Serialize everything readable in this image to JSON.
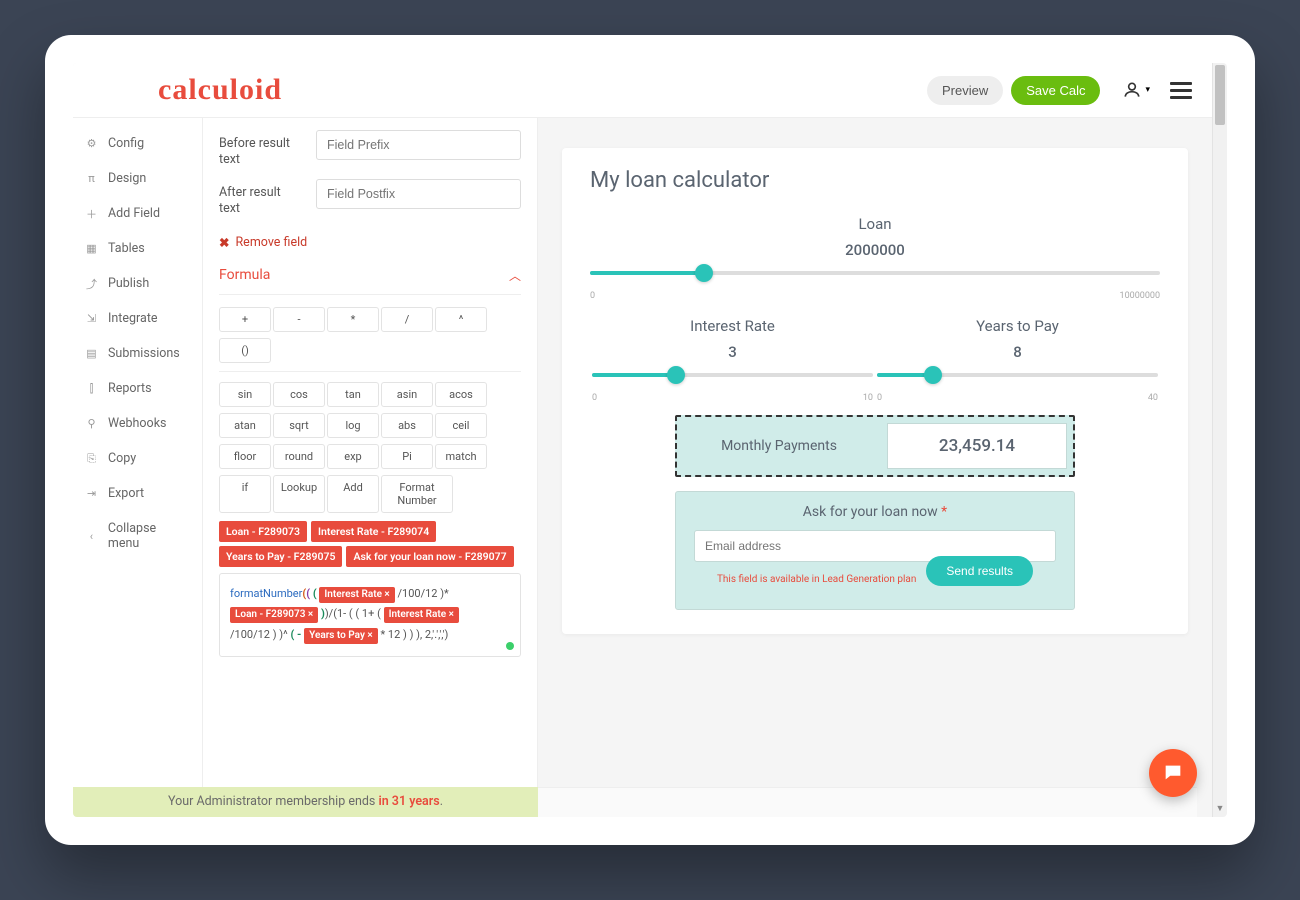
{
  "brand": "calculoid",
  "topbar": {
    "preview": "Preview",
    "save": "Save Calc"
  },
  "sidebar": [
    {
      "icon": "⚙",
      "label": "Config"
    },
    {
      "icon": "π",
      "label": "Design"
    },
    {
      "icon": "＋",
      "label": "Add Field"
    },
    {
      "icon": "▦",
      "label": "Tables"
    },
    {
      "icon": "⤴",
      "label": "Publish"
    },
    {
      "icon": "⇲",
      "label": "Integrate"
    },
    {
      "icon": "▤",
      "label": "Submissions"
    },
    {
      "icon": "⫿",
      "label": "Reports"
    },
    {
      "icon": "⚲",
      "label": "Webhooks"
    },
    {
      "icon": "⎘",
      "label": "Copy"
    },
    {
      "icon": "⇥",
      "label": "Export"
    },
    {
      "icon": "‹",
      "label": "Collapse menu"
    }
  ],
  "editor": {
    "before_label": "Before result text",
    "before_ph": "Field Prefix",
    "after_label": "After result text",
    "after_ph": "Field Postfix",
    "remove": "Remove field",
    "section": "Formula",
    "ops_basic": [
      "+",
      "-",
      "*",
      "/",
      "^",
      "()"
    ],
    "ops_fn": [
      "sin",
      "cos",
      "tan",
      "asin",
      "acos",
      "atan",
      "sqrt",
      "log",
      "abs",
      "ceil",
      "floor",
      "round",
      "exp",
      "Pi",
      "match",
      "if",
      "Lookup",
      "Add",
      "Format Number"
    ],
    "chips": [
      "Loan - F289073",
      "Interest Rate - F289074",
      "Years to Pay - F289075",
      "Ask for your loan now - F289077"
    ],
    "formula": {
      "fn": "formatNumber",
      "tok_a": "Interest Rate ×",
      "mid1": "/100/12 )",
      "tok_b": "Loan - F289073 ×",
      "mid2": ")/(1- ( ( 1+ (",
      "tok_c": "Interest Rate ×",
      "mid3": "/100/12 ) )",
      "caret": "^",
      "neg": "( -",
      "tok_d": "Years to Pay ×",
      "tail": "* 12 )  )  ), 2,'.',',')"
    }
  },
  "calc": {
    "title": "My loan calculator",
    "loan": {
      "label": "Loan",
      "value": "2000000",
      "min": "0",
      "max": "10000000",
      "pct": 20
    },
    "rate": {
      "label": "Interest Rate",
      "value": "3",
      "min": "0",
      "max": "10",
      "pct": 30
    },
    "years": {
      "label": "Years to Pay",
      "value": "8",
      "min": "0",
      "max": "40",
      "pct": 20
    },
    "result": {
      "label": "Monthly Payments",
      "value": "23,459.14"
    },
    "ask": {
      "title": "Ask for your loan now",
      "req": "*",
      "placeholder": "Email address",
      "note": "This field is available in Lead Generation plan",
      "button": "Send results"
    }
  },
  "footer": {
    "pre": "Your Administrator membership ends ",
    "bold": "in 31 years",
    "suf": "."
  }
}
